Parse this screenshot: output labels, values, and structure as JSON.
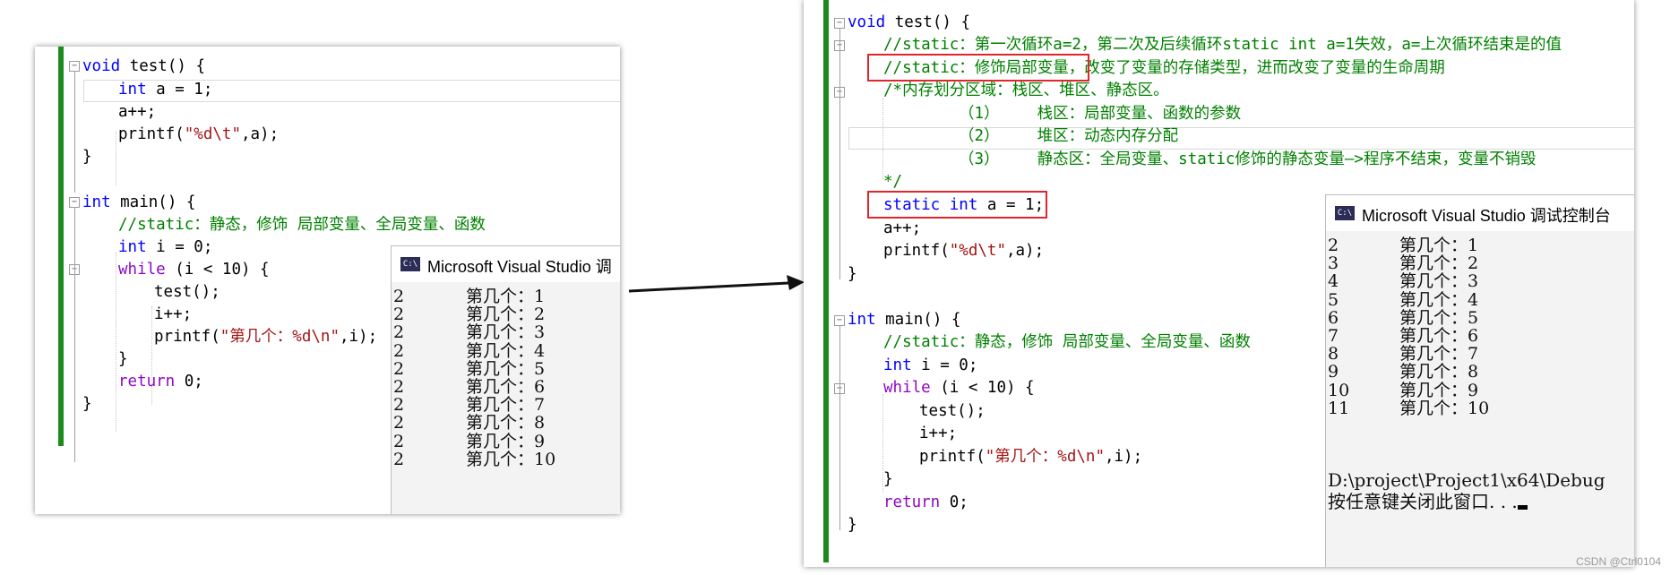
{
  "left": {
    "code": {
      "l1": {
        "kw": "void",
        "rest": " test() {"
      },
      "l2": {
        "kw": "int",
        "rest": " a = 1;"
      },
      "l3": "a++;",
      "l4": {
        "fn": "printf(",
        "s1": "\"%d\\t\"",
        "rest": ",a);"
      },
      "l5": "}",
      "l6": {
        "kw": "int",
        "rest": " main() {"
      },
      "l7": "//static：静态，修饰 局部变量、全局变量、函数",
      "l8": {
        "kw": "int",
        "rest": " i = 0;"
      },
      "l9": {
        "kw": "while",
        "rest": " (i < 10) {"
      },
      "l10": "test();",
      "l11": "i++;",
      "l12": {
        "fn": "printf(",
        "s1": "\"第几个：%d\\n\"",
        "rest": ",i);"
      },
      "l13": "}",
      "l14": {
        "kw": "return",
        "rest": " 0;"
      },
      "l15": "}"
    },
    "console": {
      "title": "Microsoft Visual Studio 调",
      "icon": "C:\\",
      "rows": [
        {
          "n": "2",
          "t": "第几个：1"
        },
        {
          "n": "2",
          "t": "第几个：2"
        },
        {
          "n": "2",
          "t": "第几个：3"
        },
        {
          "n": "2",
          "t": "第几个：4"
        },
        {
          "n": "2",
          "t": "第几个：5"
        },
        {
          "n": "2",
          "t": "第几个：6"
        },
        {
          "n": "2",
          "t": "第几个：7"
        },
        {
          "n": "2",
          "t": "第几个：8"
        },
        {
          "n": "2",
          "t": "第几个：9"
        },
        {
          "n": "2",
          "t": "第几个：10"
        }
      ]
    }
  },
  "right": {
    "code": {
      "l1": {
        "kw": "void",
        "rest": " test() {"
      },
      "l2": "//static：第一次循环a=2，第二次及后续循环static int a=1失效，a=上次循环结束是的值",
      "l3a": "//static：修饰局部变量，",
      "l3b": "改变了变量的存储类型，进而改变了变量的生命周期",
      "l4": "/*内存划分区域：栈区、堆区、静态区。",
      "l5": "（1）    栈区：局部变量、函数的参数",
      "l6": "（2）    堆区：动态内存分配",
      "l7": "（3）    静态区：全局变量、static修饰的静态变量—>程序不结束，变量不销毁",
      "l8": "*/",
      "l9": {
        "kw": "static int",
        "rest": " a = 1;"
      },
      "l10": "a++;",
      "l11": {
        "fn": "printf(",
        "s1": "\"%d\\t\"",
        "rest": ",a);"
      },
      "l12": "}",
      "l13": {
        "kw": "int",
        "rest": " main() {"
      },
      "l14": "//static：静态，修饰 局部变量、全局变量、函数",
      "l15": {
        "kw": "int",
        "rest": " i = 0;"
      },
      "l16": {
        "kw": "while",
        "rest": " (i < 10) {"
      },
      "l17": "test();",
      "l18": "i++;",
      "l19": {
        "fn": "printf(",
        "s1": "\"第几个：%d\\n\"",
        "rest": ",i);"
      },
      "l20": "}",
      "l21": {
        "kw": "return",
        "rest": " 0;"
      },
      "l22": "}"
    },
    "console": {
      "title": "Microsoft Visual Studio 调试控制台",
      "icon": "C:\\",
      "rows": [
        {
          "n": "2",
          "t": "第几个：1"
        },
        {
          "n": "3",
          "t": "第几个：2"
        },
        {
          "n": "4",
          "t": "第几个：3"
        },
        {
          "n": "5",
          "t": "第几个：4"
        },
        {
          "n": "6",
          "t": "第几个：5"
        },
        {
          "n": "7",
          "t": "第几个：6"
        },
        {
          "n": "8",
          "t": "第几个：7"
        },
        {
          "n": "9",
          "t": "第几个：8"
        },
        {
          "n": "10",
          "t": "第几个：9"
        },
        {
          "n": "11",
          "t": "第几个：10"
        }
      ],
      "path": "D:\\project\\Project1\\x64\\Debug",
      "close_msg": "按任意键关闭此窗口. . ."
    }
  },
  "watermark": "CSDN @Ctrl0104",
  "colors": {
    "keyword": "#0000ff",
    "comment": "#008000",
    "string": "#a31515",
    "gutter": "#1d8a1d",
    "highlight_box": "#e0262b"
  }
}
